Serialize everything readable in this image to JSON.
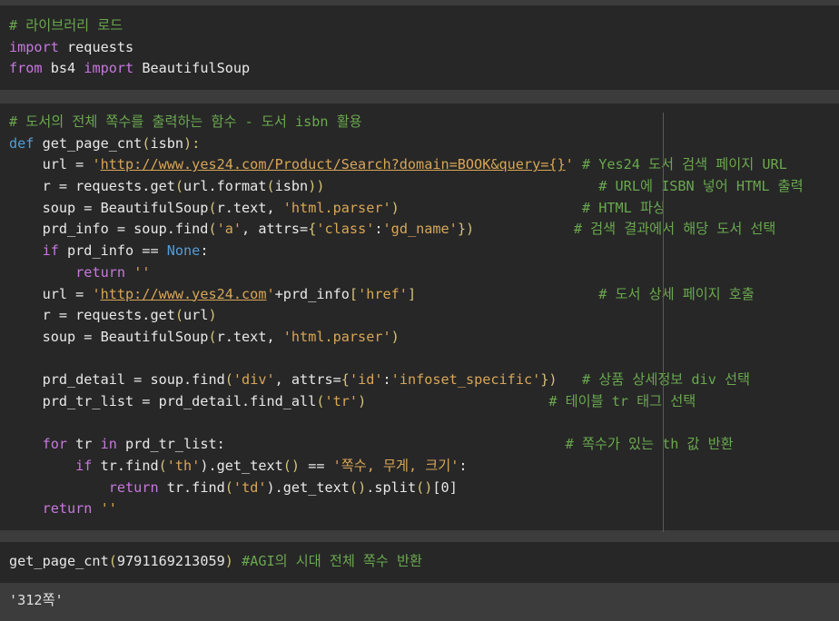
{
  "cell1": {
    "lines": [
      [
        {
          "t": "# 라이브러리 로드",
          "c": "c-comment"
        }
      ],
      [
        {
          "t": "import",
          "c": "c-kw"
        },
        {
          "t": " requests",
          "c": "c-fn"
        }
      ],
      [
        {
          "t": "from",
          "c": "c-kw"
        },
        {
          "t": " bs4 ",
          "c": "c-fn"
        },
        {
          "t": "import",
          "c": "c-kw"
        },
        {
          "t": " BeautifulSoup",
          "c": "c-fn"
        }
      ]
    ]
  },
  "cell2": {
    "lines": [
      [
        {
          "t": "# 도서의 전체 쪽수를 출력하는 함수 - 도서 isbn 활용",
          "c": "c-comment"
        }
      ],
      [
        {
          "t": "def",
          "c": "c-kw2"
        },
        {
          "t": " get_page_cnt",
          "c": "c-fn"
        },
        {
          "t": "(",
          "c": "c-paren"
        },
        {
          "t": "isbn",
          "c": "c-fn"
        },
        {
          "t": "):",
          "c": "c-paren"
        }
      ],
      [
        {
          "t": "    url = ",
          "c": "c-fn"
        },
        {
          "t": "'",
          "c": "c-str"
        },
        {
          "t": "http://www.yes24.com/Product/Search?domain=BOOK&query={}",
          "c": "c-url"
        },
        {
          "t": "'",
          "c": "c-str"
        },
        {
          "t": " # Yes24 도서 검색 페이지 URL",
          "c": "c-comment"
        }
      ],
      [
        {
          "t": "    r = requests.get",
          "c": "c-fn"
        },
        {
          "t": "(",
          "c": "c-paren"
        },
        {
          "t": "url.format",
          "c": "c-fn"
        },
        {
          "t": "(",
          "c": "c-paren"
        },
        {
          "t": "isbn",
          "c": "c-fn"
        },
        {
          "t": "))",
          "c": "c-paren"
        },
        {
          "t": "                                 # URL에 ISBN 넣어 HTML 출력",
          "c": "c-comment"
        }
      ],
      [
        {
          "t": "    soup = BeautifulSoup",
          "c": "c-fn"
        },
        {
          "t": "(",
          "c": "c-paren"
        },
        {
          "t": "r.text, ",
          "c": "c-fn"
        },
        {
          "t": "'html.parser'",
          "c": "c-str"
        },
        {
          "t": ")",
          "c": "c-paren"
        },
        {
          "t": "                      # HTML 파싱",
          "c": "c-comment"
        }
      ],
      [
        {
          "t": "    prd_info = soup.find",
          "c": "c-fn"
        },
        {
          "t": "(",
          "c": "c-paren"
        },
        {
          "t": "'a'",
          "c": "c-str"
        },
        {
          "t": ", attrs=",
          "c": "c-fn"
        },
        {
          "t": "{",
          "c": "c-paren"
        },
        {
          "t": "'class'",
          "c": "c-str"
        },
        {
          "t": ":",
          "c": "c-fn"
        },
        {
          "t": "'gd_name'",
          "c": "c-str"
        },
        {
          "t": "})",
          "c": "c-paren"
        },
        {
          "t": "            # 검색 결과에서 해당 도서 선택",
          "c": "c-comment"
        }
      ],
      [
        {
          "t": "    ",
          "c": "c-fn"
        },
        {
          "t": "if",
          "c": "c-kw"
        },
        {
          "t": " prd_info == ",
          "c": "c-fn"
        },
        {
          "t": "None",
          "c": "c-none"
        },
        {
          "t": ":",
          "c": "c-fn"
        }
      ],
      [
        {
          "t": "        ",
          "c": "c-fn"
        },
        {
          "t": "return",
          "c": "c-kw"
        },
        {
          "t": " ",
          "c": "c-fn"
        },
        {
          "t": "''",
          "c": "c-str"
        }
      ],
      [
        {
          "t": "    url = ",
          "c": "c-fn"
        },
        {
          "t": "'",
          "c": "c-str"
        },
        {
          "t": "http://www.yes24.com",
          "c": "c-url"
        },
        {
          "t": "'",
          "c": "c-str"
        },
        {
          "t": "+prd_info",
          "c": "c-fn"
        },
        {
          "t": "[",
          "c": "c-paren"
        },
        {
          "t": "'href'",
          "c": "c-str"
        },
        {
          "t": "]",
          "c": "c-paren"
        },
        {
          "t": "                      # 도서 상세 페이지 호출",
          "c": "c-comment"
        }
      ],
      [
        {
          "t": "    r = requests.get",
          "c": "c-fn"
        },
        {
          "t": "(",
          "c": "c-paren"
        },
        {
          "t": "url",
          "c": "c-fn"
        },
        {
          "t": ")",
          "c": "c-paren"
        }
      ],
      [
        {
          "t": "    soup = BeautifulSoup",
          "c": "c-fn"
        },
        {
          "t": "(",
          "c": "c-paren"
        },
        {
          "t": "r.text, ",
          "c": "c-fn"
        },
        {
          "t": "'html.parser'",
          "c": "c-str"
        },
        {
          "t": ")",
          "c": "c-paren"
        }
      ],
      [
        {
          "t": "",
          "c": "c-fn"
        }
      ],
      [
        {
          "t": "    prd_detail = soup.find",
          "c": "c-fn"
        },
        {
          "t": "(",
          "c": "c-paren"
        },
        {
          "t": "'div'",
          "c": "c-str"
        },
        {
          "t": ", attrs=",
          "c": "c-fn"
        },
        {
          "t": "{",
          "c": "c-paren"
        },
        {
          "t": "'id'",
          "c": "c-str"
        },
        {
          "t": ":",
          "c": "c-fn"
        },
        {
          "t": "'infoset_specific'",
          "c": "c-str"
        },
        {
          "t": "})",
          "c": "c-paren"
        },
        {
          "t": "   # 상품 상세정보 div 선택",
          "c": "c-comment"
        }
      ],
      [
        {
          "t": "    prd_tr_list = prd_detail.find_all",
          "c": "c-fn"
        },
        {
          "t": "(",
          "c": "c-paren"
        },
        {
          "t": "'tr'",
          "c": "c-str"
        },
        {
          "t": ")",
          "c": "c-paren"
        },
        {
          "t": "                      # 테이블 tr 태그 선택",
          "c": "c-comment"
        }
      ],
      [
        {
          "t": "",
          "c": "c-fn"
        }
      ],
      [
        {
          "t": "    ",
          "c": "c-fn"
        },
        {
          "t": "for",
          "c": "c-kw"
        },
        {
          "t": " tr ",
          "c": "c-fn"
        },
        {
          "t": "in",
          "c": "c-kw"
        },
        {
          "t": " prd_tr_list:",
          "c": "c-fn"
        },
        {
          "t": "                                         # 쪽수가 있는 th 값 반환",
          "c": "c-comment"
        }
      ],
      [
        {
          "t": "        ",
          "c": "c-fn"
        },
        {
          "t": "if",
          "c": "c-kw"
        },
        {
          "t": " tr.find",
          "c": "c-fn"
        },
        {
          "t": "(",
          "c": "c-paren"
        },
        {
          "t": "'th'",
          "c": "c-str"
        },
        {
          "t": ").get_text",
          "c": "c-fn"
        },
        {
          "t": "()",
          "c": "c-paren"
        },
        {
          "t": " == ",
          "c": "c-fn"
        },
        {
          "t": "'쪽수, 무게, 크기'",
          "c": "c-str"
        },
        {
          "t": ":",
          "c": "c-fn"
        }
      ],
      [
        {
          "t": "            ",
          "c": "c-fn"
        },
        {
          "t": "return",
          "c": "c-kw"
        },
        {
          "t": " tr.find",
          "c": "c-fn"
        },
        {
          "t": "(",
          "c": "c-paren"
        },
        {
          "t": "'td'",
          "c": "c-str"
        },
        {
          "t": ").get_text",
          "c": "c-fn"
        },
        {
          "t": "()",
          "c": "c-paren"
        },
        {
          "t": ".split",
          "c": "c-fn"
        },
        {
          "t": "()",
          "c": "c-paren"
        },
        {
          "t": "[0]",
          "c": "c-num"
        }
      ],
      [
        {
          "t": "    ",
          "c": "c-fn"
        },
        {
          "t": "return",
          "c": "c-kw"
        },
        {
          "t": " ",
          "c": "c-fn"
        },
        {
          "t": "''",
          "c": "c-str"
        }
      ]
    ]
  },
  "cell3": {
    "lines": [
      [
        {
          "t": "get_page_cnt",
          "c": "c-fn"
        },
        {
          "t": "(",
          "c": "c-paren"
        },
        {
          "t": "9791169213059",
          "c": "c-num"
        },
        {
          "t": ")",
          "c": "c-paren"
        },
        {
          "t": " #AGI의 시대 전체 쪽수 반환",
          "c": "c-comment"
        }
      ]
    ]
  },
  "output": {
    "text": "'312쪽'"
  }
}
